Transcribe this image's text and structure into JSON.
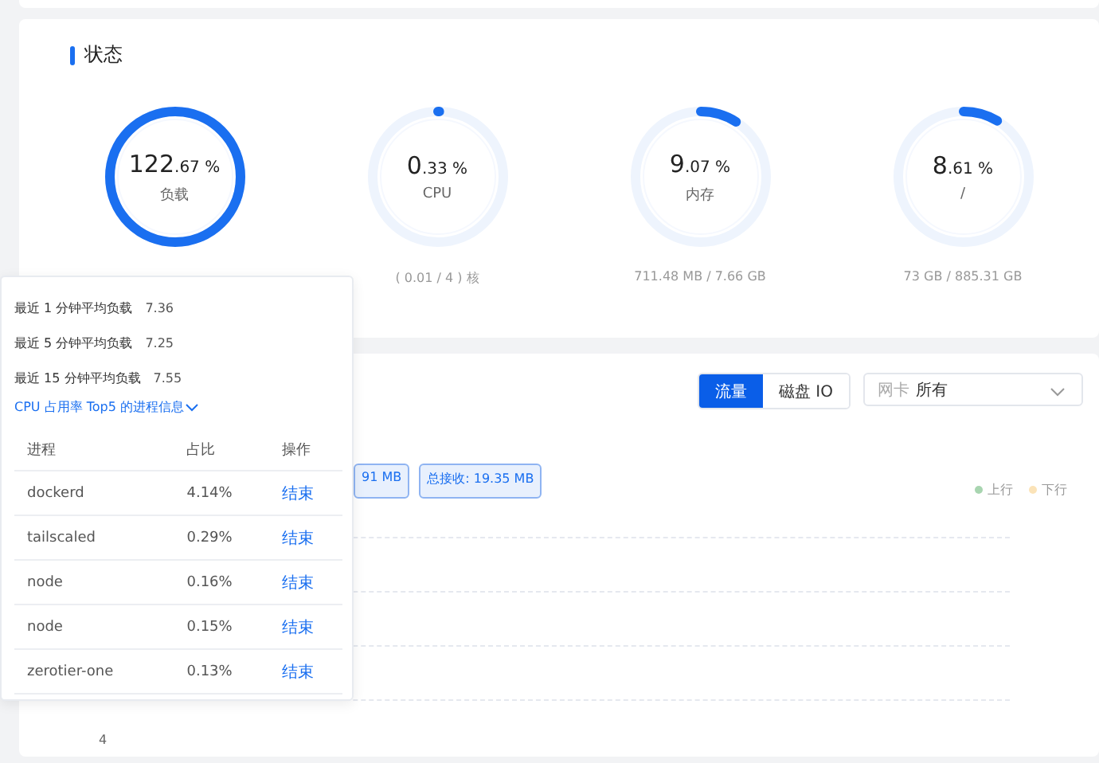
{
  "status_card": {
    "title": "状态",
    "gauges": [
      {
        "integer": "122",
        "decimal": ".67 %",
        "label": "负载",
        "level": 1
      },
      {
        "integer": "0",
        "decimal": ".33 %",
        "label": "CPU",
        "level": 0.0033,
        "caption": "( 0.01 / 4 ) 核"
      },
      {
        "integer": "9",
        "decimal": ".07 %",
        "label": "内存",
        "level": 0.0907,
        "caption": "711.48 MB / 7.66 GB"
      },
      {
        "integer": "8",
        "decimal": ".61 %",
        "label": "/",
        "level": 0.0861,
        "caption": "73 GB / 885.31 GB"
      }
    ]
  },
  "traffic_card": {
    "segments": [
      {
        "label": "流量",
        "selected": true
      },
      {
        "label": "磁盘 IO",
        "selected": false
      }
    ],
    "select": {
      "prefix": "网卡",
      "value": "所有"
    },
    "tags": [
      "91 MB",
      "总接收: 19.35 MB"
    ],
    "legend": [
      {
        "label": "上行",
        "color": "#a8d5b0"
      },
      {
        "label": "下行",
        "color": "#fbe3b8"
      }
    ],
    "axis_labels": [
      "4"
    ]
  },
  "popover": {
    "loads": [
      {
        "label": "最近 1 分钟平均负载",
        "value": "7.36"
      },
      {
        "label": "最近 5 分钟平均负载",
        "value": "7.25"
      },
      {
        "label": "最近 15 分钟平均负载",
        "value": "7.55"
      }
    ],
    "link": "CPU 占用率 Top5 的进程信息",
    "columns": [
      "进程",
      "占比",
      "操作"
    ],
    "rows": [
      {
        "name": "dockerd",
        "share": "4.14%",
        "action": "结束"
      },
      {
        "name": "tailscaled",
        "share": "0.29%",
        "action": "结束"
      },
      {
        "name": "node",
        "share": "0.16%",
        "action": "结束"
      },
      {
        "name": "node",
        "share": "0.15%",
        "action": "结束"
      },
      {
        "name": "zerotier-one",
        "share": "0.13%",
        "action": "结束"
      }
    ]
  }
}
